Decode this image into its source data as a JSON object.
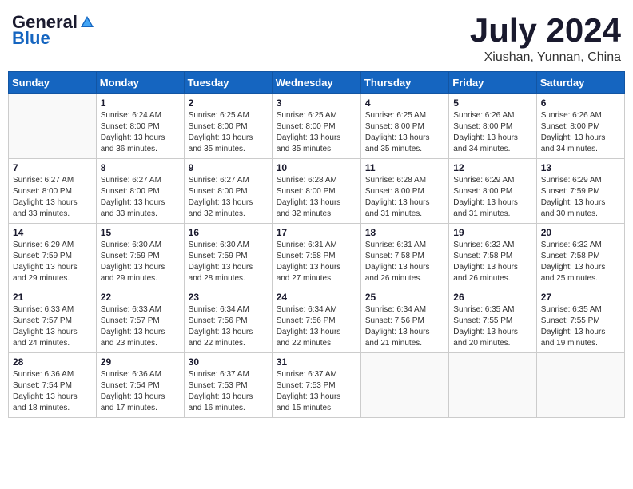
{
  "logo": {
    "general": "General",
    "blue": "Blue"
  },
  "header": {
    "month": "July 2024",
    "location": "Xiushan, Yunnan, China"
  },
  "weekdays": [
    "Sunday",
    "Monday",
    "Tuesday",
    "Wednesday",
    "Thursday",
    "Friday",
    "Saturday"
  ],
  "weeks": [
    [
      {
        "day": "",
        "info": ""
      },
      {
        "day": "1",
        "info": "Sunrise: 6:24 AM\nSunset: 8:00 PM\nDaylight: 13 hours\nand 36 minutes."
      },
      {
        "day": "2",
        "info": "Sunrise: 6:25 AM\nSunset: 8:00 PM\nDaylight: 13 hours\nand 35 minutes."
      },
      {
        "day": "3",
        "info": "Sunrise: 6:25 AM\nSunset: 8:00 PM\nDaylight: 13 hours\nand 35 minutes."
      },
      {
        "day": "4",
        "info": "Sunrise: 6:25 AM\nSunset: 8:00 PM\nDaylight: 13 hours\nand 35 minutes."
      },
      {
        "day": "5",
        "info": "Sunrise: 6:26 AM\nSunset: 8:00 PM\nDaylight: 13 hours\nand 34 minutes."
      },
      {
        "day": "6",
        "info": "Sunrise: 6:26 AM\nSunset: 8:00 PM\nDaylight: 13 hours\nand 34 minutes."
      }
    ],
    [
      {
        "day": "7",
        "info": "Sunrise: 6:27 AM\nSunset: 8:00 PM\nDaylight: 13 hours\nand 33 minutes."
      },
      {
        "day": "8",
        "info": "Sunrise: 6:27 AM\nSunset: 8:00 PM\nDaylight: 13 hours\nand 33 minutes."
      },
      {
        "day": "9",
        "info": "Sunrise: 6:27 AM\nSunset: 8:00 PM\nDaylight: 13 hours\nand 32 minutes."
      },
      {
        "day": "10",
        "info": "Sunrise: 6:28 AM\nSunset: 8:00 PM\nDaylight: 13 hours\nand 32 minutes."
      },
      {
        "day": "11",
        "info": "Sunrise: 6:28 AM\nSunset: 8:00 PM\nDaylight: 13 hours\nand 31 minutes."
      },
      {
        "day": "12",
        "info": "Sunrise: 6:29 AM\nSunset: 8:00 PM\nDaylight: 13 hours\nand 31 minutes."
      },
      {
        "day": "13",
        "info": "Sunrise: 6:29 AM\nSunset: 7:59 PM\nDaylight: 13 hours\nand 30 minutes."
      }
    ],
    [
      {
        "day": "14",
        "info": "Sunrise: 6:29 AM\nSunset: 7:59 PM\nDaylight: 13 hours\nand 29 minutes."
      },
      {
        "day": "15",
        "info": "Sunrise: 6:30 AM\nSunset: 7:59 PM\nDaylight: 13 hours\nand 29 minutes."
      },
      {
        "day": "16",
        "info": "Sunrise: 6:30 AM\nSunset: 7:59 PM\nDaylight: 13 hours\nand 28 minutes."
      },
      {
        "day": "17",
        "info": "Sunrise: 6:31 AM\nSunset: 7:58 PM\nDaylight: 13 hours\nand 27 minutes."
      },
      {
        "day": "18",
        "info": "Sunrise: 6:31 AM\nSunset: 7:58 PM\nDaylight: 13 hours\nand 26 minutes."
      },
      {
        "day": "19",
        "info": "Sunrise: 6:32 AM\nSunset: 7:58 PM\nDaylight: 13 hours\nand 26 minutes."
      },
      {
        "day": "20",
        "info": "Sunrise: 6:32 AM\nSunset: 7:58 PM\nDaylight: 13 hours\nand 25 minutes."
      }
    ],
    [
      {
        "day": "21",
        "info": "Sunrise: 6:33 AM\nSunset: 7:57 PM\nDaylight: 13 hours\nand 24 minutes."
      },
      {
        "day": "22",
        "info": "Sunrise: 6:33 AM\nSunset: 7:57 PM\nDaylight: 13 hours\nand 23 minutes."
      },
      {
        "day": "23",
        "info": "Sunrise: 6:34 AM\nSunset: 7:56 PM\nDaylight: 13 hours\nand 22 minutes."
      },
      {
        "day": "24",
        "info": "Sunrise: 6:34 AM\nSunset: 7:56 PM\nDaylight: 13 hours\nand 22 minutes."
      },
      {
        "day": "25",
        "info": "Sunrise: 6:34 AM\nSunset: 7:56 PM\nDaylight: 13 hours\nand 21 minutes."
      },
      {
        "day": "26",
        "info": "Sunrise: 6:35 AM\nSunset: 7:55 PM\nDaylight: 13 hours\nand 20 minutes."
      },
      {
        "day": "27",
        "info": "Sunrise: 6:35 AM\nSunset: 7:55 PM\nDaylight: 13 hours\nand 19 minutes."
      }
    ],
    [
      {
        "day": "28",
        "info": "Sunrise: 6:36 AM\nSunset: 7:54 PM\nDaylight: 13 hours\nand 18 minutes."
      },
      {
        "day": "29",
        "info": "Sunrise: 6:36 AM\nSunset: 7:54 PM\nDaylight: 13 hours\nand 17 minutes."
      },
      {
        "day": "30",
        "info": "Sunrise: 6:37 AM\nSunset: 7:53 PM\nDaylight: 13 hours\nand 16 minutes."
      },
      {
        "day": "31",
        "info": "Sunrise: 6:37 AM\nSunset: 7:53 PM\nDaylight: 13 hours\nand 15 minutes."
      },
      {
        "day": "",
        "info": ""
      },
      {
        "day": "",
        "info": ""
      },
      {
        "day": "",
        "info": ""
      }
    ]
  ]
}
